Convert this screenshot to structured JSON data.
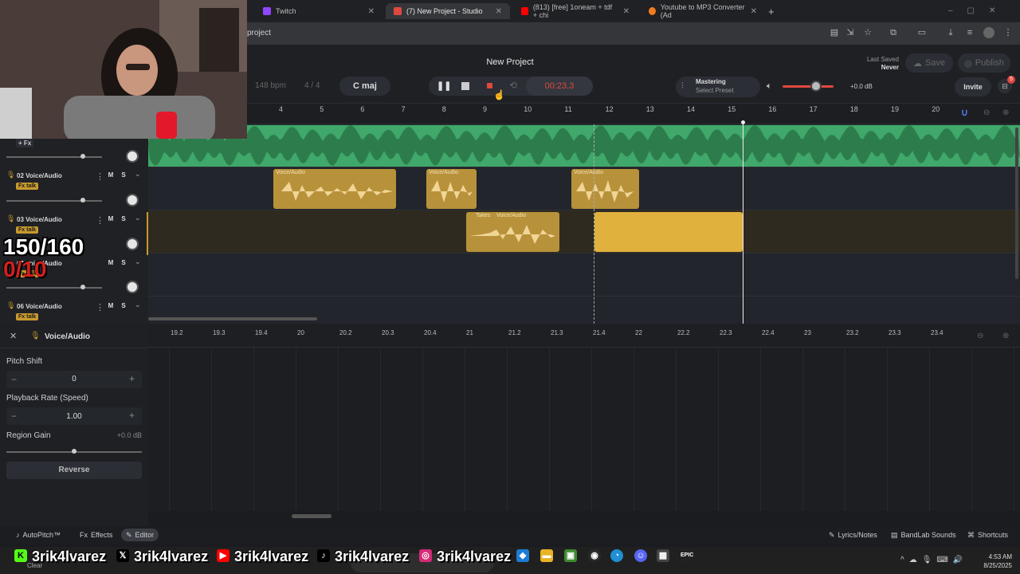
{
  "browser": {
    "tabs": [
      {
        "title": "Twitch",
        "color": "#9146ff"
      },
      {
        "title": "(7) New Project - Studio",
        "color": "#e0483e",
        "active": true
      },
      {
        "title": "(813) [free] 1oneam + tdf + chi",
        "color": "#ff0000"
      },
      {
        "title": "Youtube to MP3 Converter (Ad",
        "color": "#f07c1e"
      }
    ],
    "new_tab": "+",
    "address": "project"
  },
  "header": {
    "project_title": "New Project",
    "bpm_value": "148",
    "bpm_unit": "bpm",
    "time_sig": "4 / 4",
    "key": "C maj",
    "timer": "00:23.3",
    "mastering_label": "Mastering",
    "mastering_preset": "Select Preset",
    "volume_db": "+0.0 dB",
    "last_saved_label": "Last Saved",
    "last_saved_value": "Never",
    "save_label": "Save",
    "publish_label": "Publish",
    "invite_label": "Invite",
    "notif_count": "5"
  },
  "ruler": [
    "4",
    "5",
    "6",
    "7",
    "8",
    "9",
    "10",
    "11",
    "12",
    "13",
    "14",
    "15",
    "16",
    "17",
    "18",
    "19",
    "20"
  ],
  "tracks": [
    {
      "fx_label": "+ Fx"
    },
    {
      "number": "02",
      "name": "Voice/Audio",
      "fx_tag": "Fx talk",
      "m": "M",
      "s": "S"
    },
    {
      "number": "03",
      "name": "Voice/Audio",
      "fx_tag": "Fx talk",
      "m": "M",
      "s": "S"
    },
    {
      "number": "04",
      "name": "Voice/Audio",
      "fx_tag": "Fx talk",
      "m": "M",
      "s": "S"
    },
    {
      "number": "06",
      "name": "Voice/Audio",
      "fx_tag": "Fx talk",
      "m": "M",
      "s": "S"
    }
  ],
  "regions": {
    "lane2_label": "Voice/Audio",
    "lane3_label": "Voice/Audio",
    "takes_label": "Takes"
  },
  "lower_ruler": [
    "19.2",
    "19.3",
    "19.4",
    "20",
    "20.2",
    "20.3",
    "20.4",
    "21",
    "21.2",
    "21.3",
    "21.4",
    "22",
    "22.2",
    "22.3",
    "22.4",
    "23",
    "23.2",
    "23.3",
    "23.4"
  ],
  "panel": {
    "title": "Voice/Audio",
    "pitch_shift_label": "Pitch Shift",
    "pitch_shift_value": "0",
    "playback_rate_label": "Playback Rate (Speed)",
    "playback_rate_value": "1.00",
    "region_gain_label": "Region Gain",
    "region_gain_value": "+0.0 dB",
    "reverse_label": "Reverse",
    "minus": "−",
    "plus": "+"
  },
  "footer": {
    "autopitch": "AutoPitch™",
    "effects": "Effects",
    "editor": "Editor",
    "lyrics": "Lyrics/Notes",
    "bandlab_sounds": "BandLab Sounds",
    "shortcuts": "Shortcuts"
  },
  "overlay": {
    "count": "150/160",
    "sub": "0/10",
    "socials": [
      "3rik4lvarez",
      "3rik4lvarez",
      "3rik4lvarez",
      "3rik4lvarez",
      "3rik4lvarez"
    ]
  },
  "taskbar": {
    "weather": "Clear",
    "time": "4:53 AM",
    "date": "8/25/2025"
  },
  "colors": {
    "accent_green": "#3fa86a",
    "accent_gold": "#c89a2e",
    "record_red": "#e0483e"
  }
}
